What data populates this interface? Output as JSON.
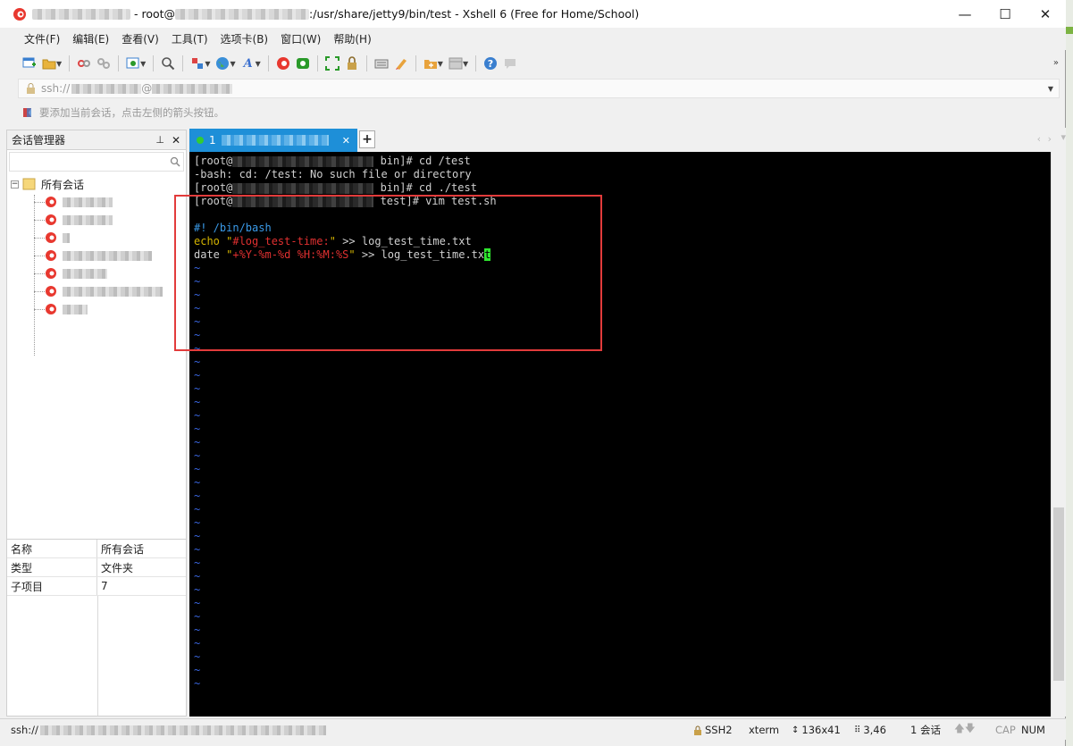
{
  "title": {
    "prefix": "- root@",
    "path": ":/usr/share/jetty9/bin/test - Xshell 6 (Free for Home/School)"
  },
  "window_controls": {
    "minimize": "—",
    "maximize": "☐",
    "close": "✕"
  },
  "menu": [
    "文件(F)",
    "编辑(E)",
    "查看(V)",
    "工具(T)",
    "选项卡(B)",
    "窗口(W)",
    "帮助(H)"
  ],
  "address": {
    "prefix": "ssh://",
    "at": "@"
  },
  "hint": "要添加当前会话，点击左侧的箭头按钮。",
  "session_manager": {
    "title": "会话管理器",
    "root": "所有会话",
    "properties": [
      {
        "key": "名称",
        "value": "所有会话"
      },
      {
        "key": "类型",
        "value": "文件夹"
      },
      {
        "key": "子项目",
        "value": "7"
      }
    ]
  },
  "tab": {
    "label": "1"
  },
  "terminal": {
    "lines": [
      {
        "type": "prompt",
        "pre": "[root@",
        "post": " bin]# cd /test"
      },
      {
        "type": "plain",
        "text": "-bash: cd: /test: No such file or directory"
      },
      {
        "type": "prompt",
        "pre": "[root@",
        "post": " bin]# cd ./test"
      },
      {
        "type": "prompt",
        "pre": "[root@",
        "post": " test]# vim test.sh"
      },
      {
        "type": "blank"
      },
      {
        "type": "shebang",
        "text": "#! /bin/bash"
      },
      {
        "type": "echo",
        "cmd": "echo ",
        "str": "\"#log_test-time:\"",
        "rest": " >> log_test_time.txt"
      },
      {
        "type": "date",
        "cmd": "date ",
        "q1": "\"",
        "fmt": "+%Y-%m-%d %H:%M:%S",
        "q2": "\"",
        "rest": " >> log_test_time.tx",
        "cursor": "t"
      }
    ],
    "tilde": "~",
    "tilde_count": 32
  },
  "status": {
    "prefix": "ssh://",
    "protocol": "SSH2",
    "terminal": "xterm",
    "size": "136x41",
    "position": "3,46",
    "sessions": "1 会话",
    "cap": "CAP",
    "num": "NUM"
  },
  "colors": {
    "tab_active": "#1e8fd8",
    "terminal_bg": "#000000",
    "tilde": "#3a66e0",
    "string_yellow": "#d4b400",
    "format_red": "#e03030",
    "cursor": "#2fe82f",
    "highlight_box": "#e23b3b"
  }
}
